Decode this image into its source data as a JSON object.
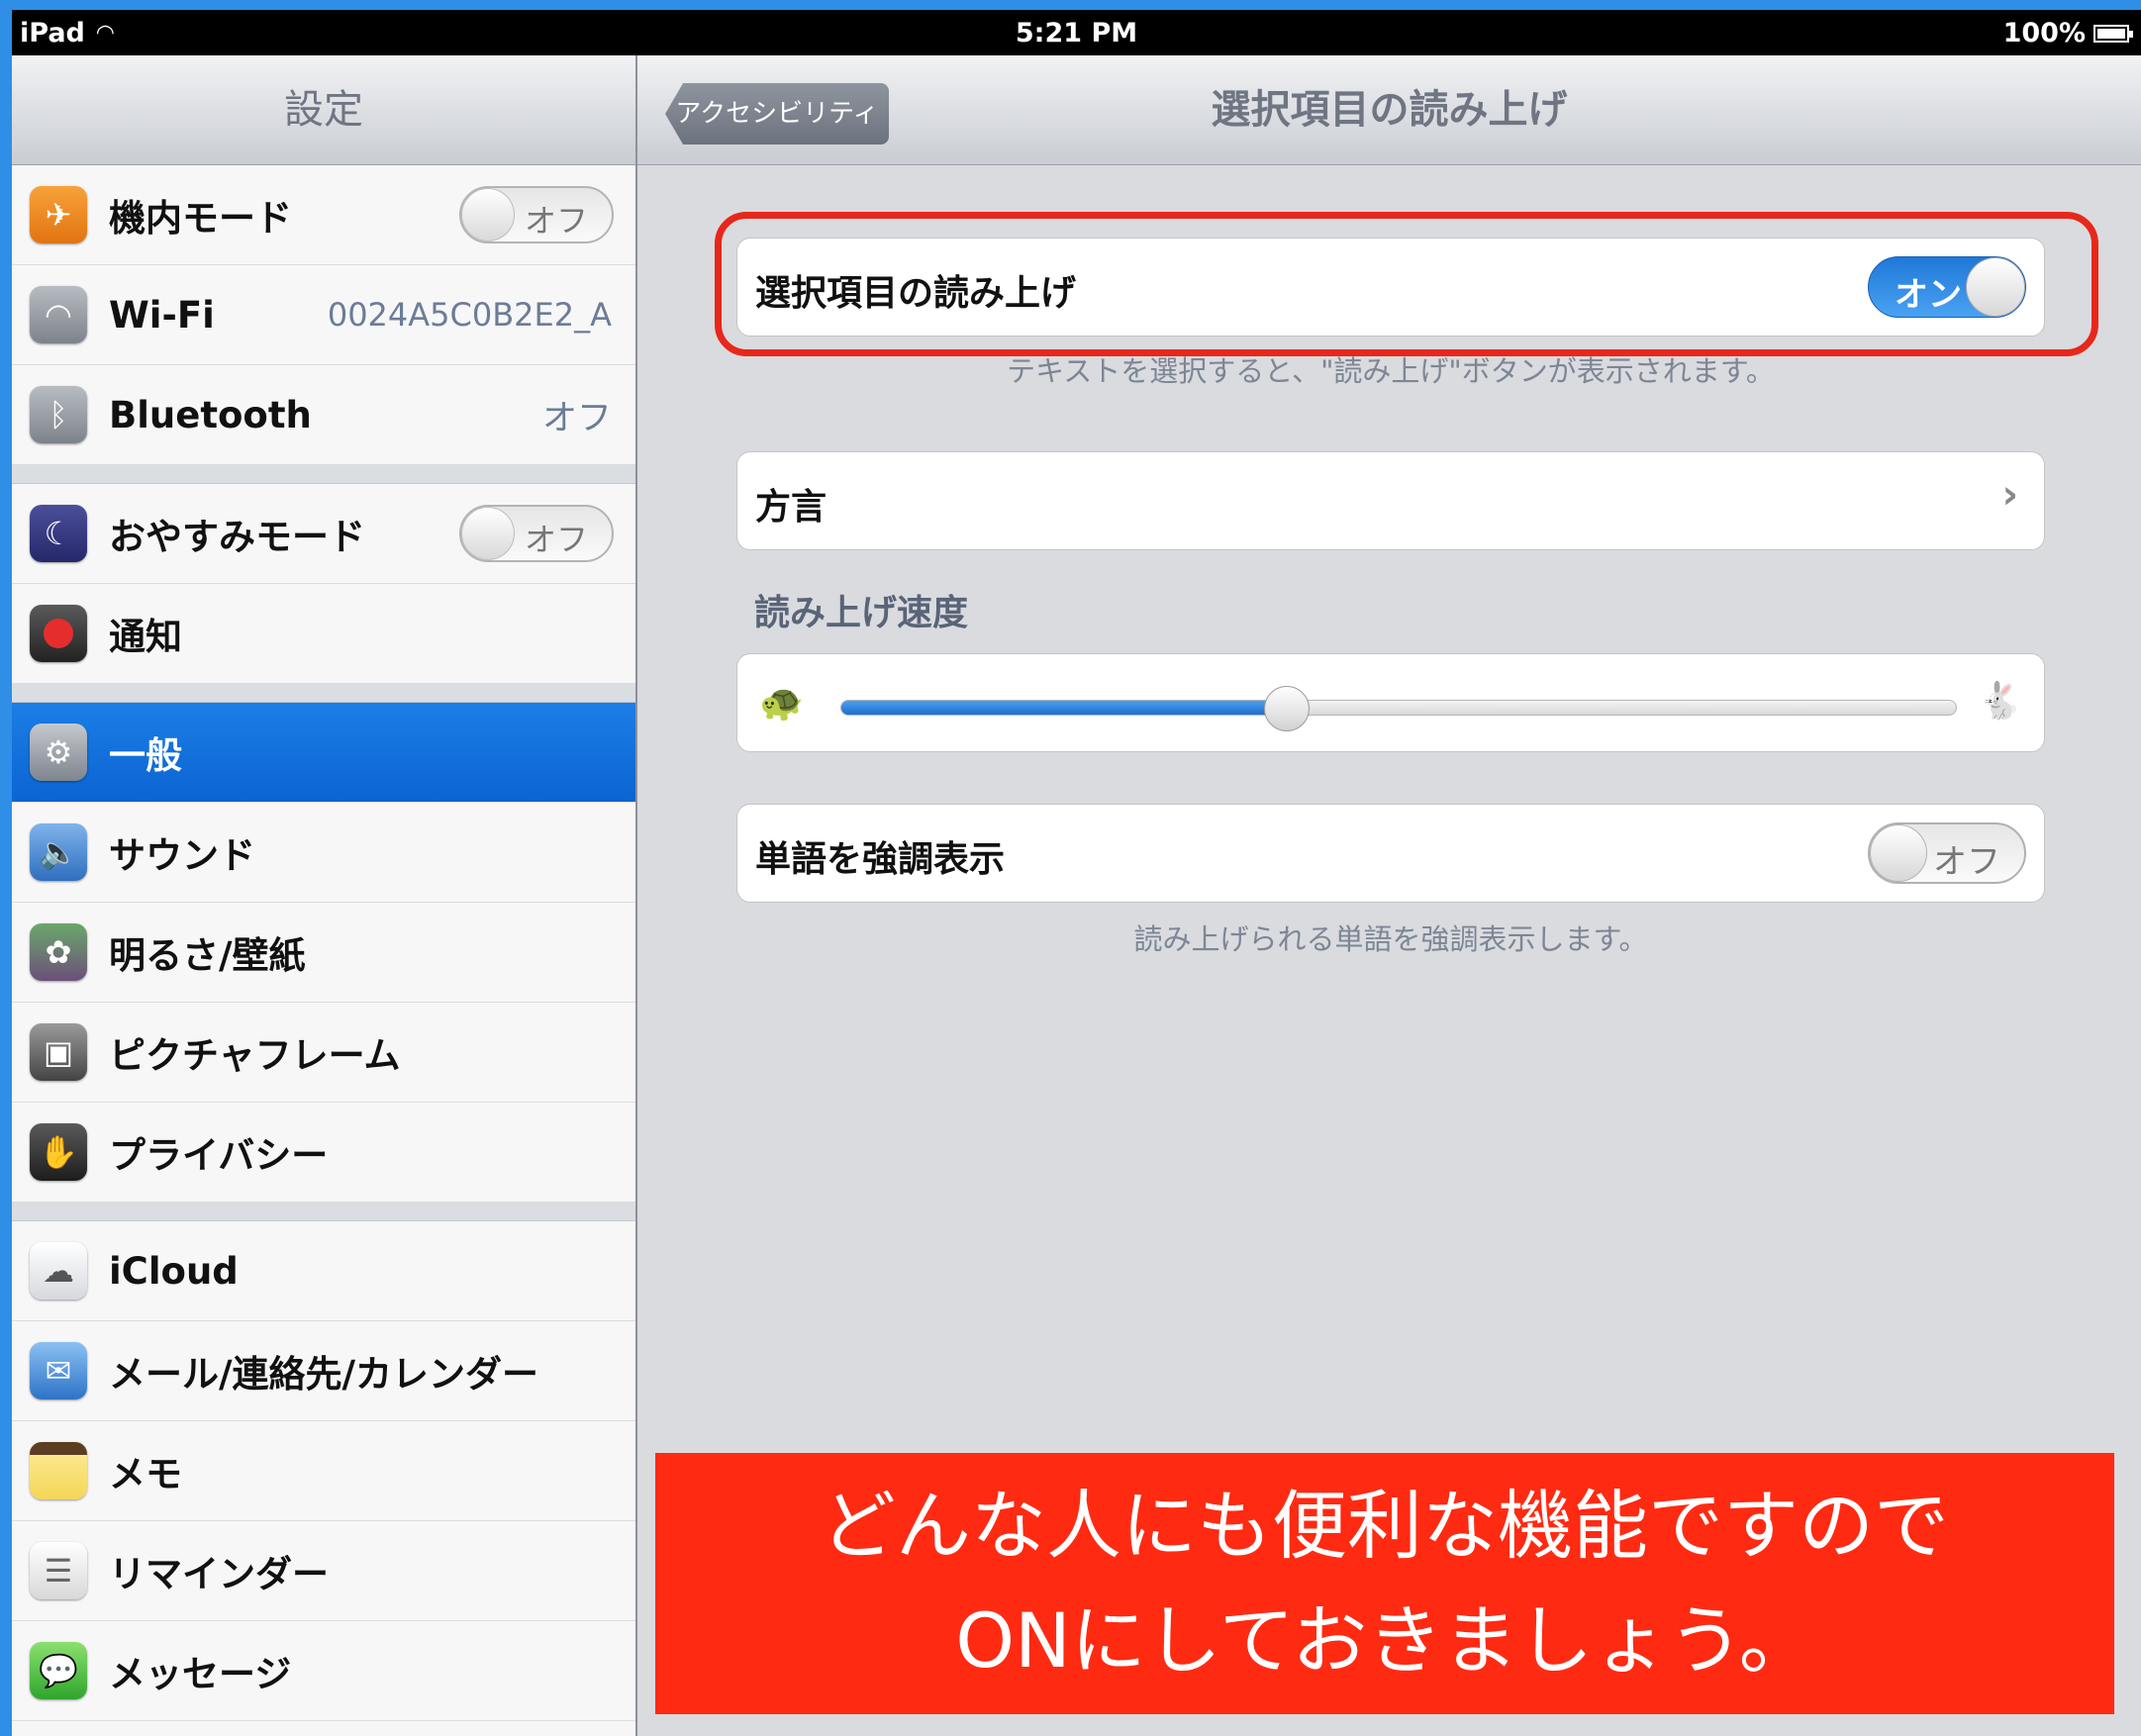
{
  "statusbar": {
    "device": "iPad",
    "time": "5:21 PM",
    "battery": "100%"
  },
  "sidebar": {
    "title": "設定",
    "items": [
      {
        "label": "機内モード",
        "icon": "airplane-icon",
        "switch": "オフ"
      },
      {
        "label": "Wi-Fi",
        "icon": "wifi-icon",
        "value": "0024A5C0B2E2_A"
      },
      {
        "label": "Bluetooth",
        "icon": "bluetooth-icon",
        "value": "オフ"
      },
      {
        "label": "おやすみモード",
        "icon": "moon-icon",
        "switch": "オフ"
      },
      {
        "label": "通知",
        "icon": "notification-icon"
      },
      {
        "label": "一般",
        "icon": "gear-icon",
        "selected": true
      },
      {
        "label": "サウンド",
        "icon": "speaker-icon"
      },
      {
        "label": "明るさ/壁紙",
        "icon": "flower-icon"
      },
      {
        "label": "ピクチャフレーム",
        "icon": "picture-frame-icon"
      },
      {
        "label": "プライバシー",
        "icon": "hand-icon"
      },
      {
        "label": "iCloud",
        "icon": "cloud-icon"
      },
      {
        "label": "メール/連絡先/カレンダー",
        "icon": "mail-icon"
      },
      {
        "label": "メモ",
        "icon": "notes-icon"
      },
      {
        "label": "リマインダー",
        "icon": "reminders-icon"
      },
      {
        "label": "メッセージ",
        "icon": "messages-icon"
      }
    ]
  },
  "main": {
    "back_button": "アクセシビリティ",
    "title": "選択項目の読み上げ",
    "speak_selection": {
      "label": "選択項目の読み上げ",
      "switch": "オン",
      "footnote": "テキストを選択すると、\"読み上げ\"ボタンが表示されます。"
    },
    "dialect": {
      "label": "方言",
      "chevron": "›"
    },
    "speaking_rate": {
      "header": "読み上げ速度",
      "value": 0.4
    },
    "highlight_words": {
      "label": "単語を強調表示",
      "switch": "オフ",
      "footnote": "読み上げられる単語を強調表示します。"
    }
  },
  "banner": {
    "line1": "どんな人にも便利な機能ですので",
    "line2": "ONにしておきましょう。"
  },
  "colors": {
    "accent": "#0b64d2",
    "banner": "#ff2a12",
    "highlight": "#e8271b",
    "background": "#2f8ee6"
  }
}
